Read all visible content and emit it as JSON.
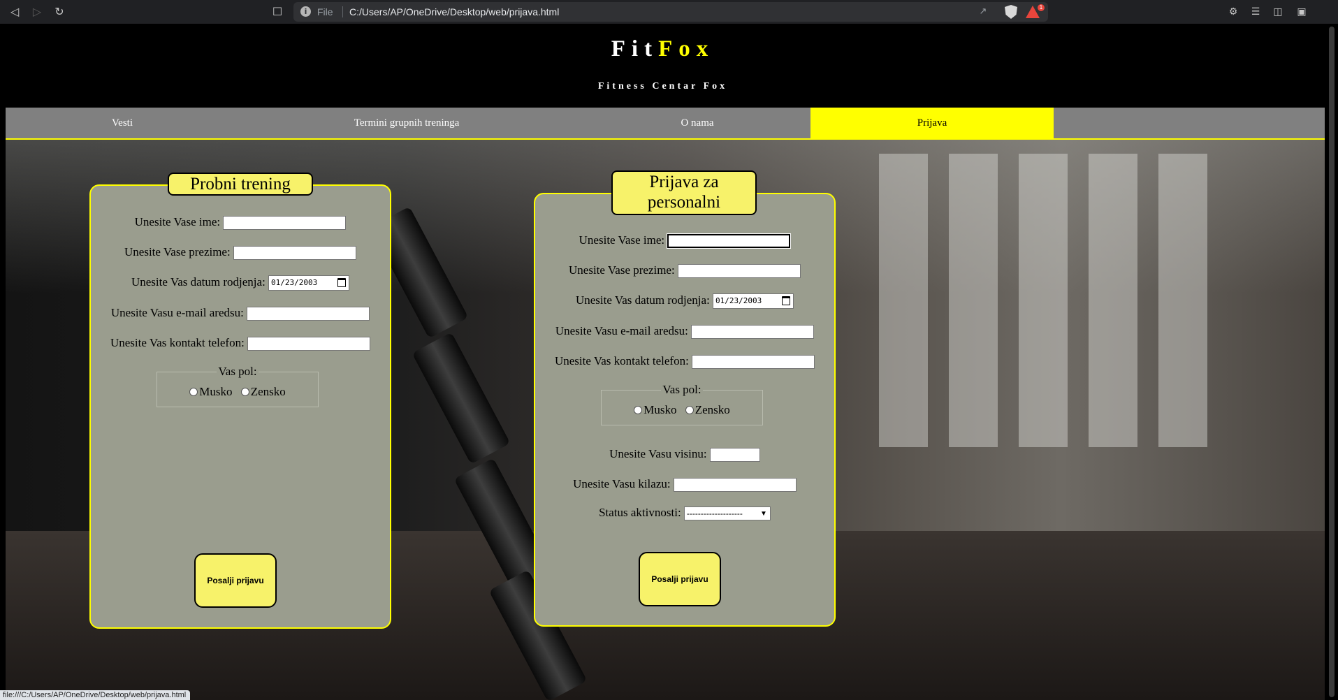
{
  "browser": {
    "scheme_label": "File",
    "url": "C:/Users/AP/OneDrive/Desktop/web/prijava.html",
    "rewards_badge": "1",
    "status_url": "file:///C:/Users/AP/OneDrive/Desktop/web/prijava.html"
  },
  "header": {
    "brand_part1": "Fit",
    "brand_part2": "Fox",
    "tagline": "Fitness Centar Fox"
  },
  "nav": {
    "items": [
      {
        "label": "Vesti"
      },
      {
        "label": "Termini grupnih treninga"
      },
      {
        "label": "O nama"
      },
      {
        "label": "Prijava"
      }
    ],
    "active_index": 3
  },
  "colors": {
    "accent": "#ffff00",
    "form_bg": "#9a9d8e",
    "button_bg": "#f7f26a",
    "nav_bg": "#808080"
  },
  "form_trial": {
    "title": "Probni trening",
    "first_name_label": "Unesite Vase ime:",
    "first_name_value": "",
    "last_name_label": "Unesite Vase prezime:",
    "last_name_value": "",
    "birth_date_label": "Unesite Vas datum rodjenja:",
    "birth_date_value": "01/23/2003",
    "email_label": "Unesite Vasu e-mail aredsu:",
    "email_value": "",
    "phone_label": "Unesite Vas kontakt telefon:",
    "phone_value": "",
    "gender_legend": "Vas pol:",
    "gender_male": "Musko",
    "gender_female": "Zensko",
    "submit_label": "Posalji prijavu"
  },
  "form_personal": {
    "title": "Prijava za personalni",
    "first_name_label": "Unesite Vase ime:",
    "first_name_value": "",
    "last_name_label": "Unesite Vase prezime:",
    "last_name_value": "",
    "birth_date_label": "Unesite Vas datum rodjenja:",
    "birth_date_value": "01/23/2003",
    "email_label": "Unesite Vasu e-mail aredsu:",
    "email_value": "",
    "phone_label": "Unesite Vas kontakt telefon:",
    "phone_value": "",
    "gender_legend": "Vas pol:",
    "gender_male": "Musko",
    "gender_female": "Zensko",
    "height_label": "Unesite Vasu visinu:",
    "height_value": "",
    "weight_label": "Unesite Vasu kilazu:",
    "weight_value": "",
    "activity_label": "Status aktivnosti:",
    "activity_selected": "--------------------",
    "submit_label": "Posalji prijavu"
  }
}
